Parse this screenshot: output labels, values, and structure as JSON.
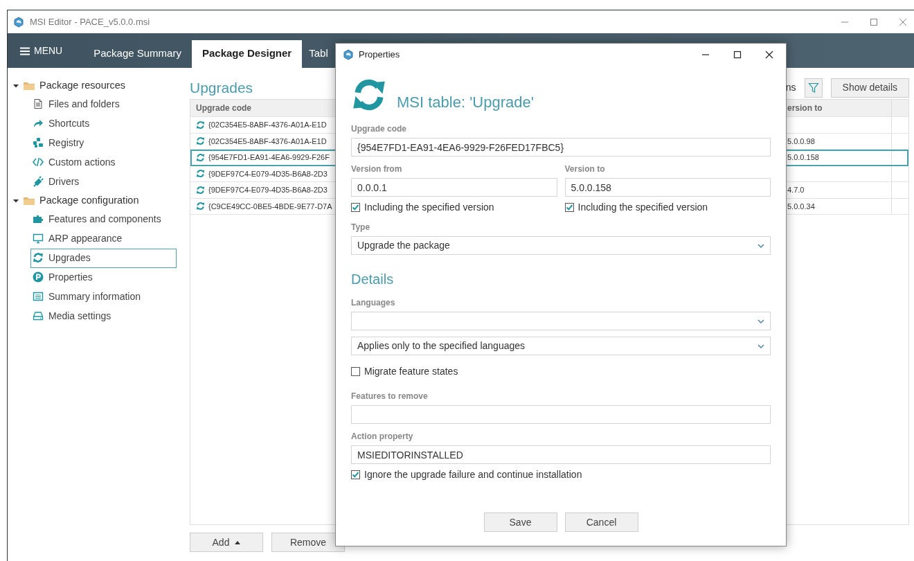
{
  "window": {
    "title": "MSI Editor - PACE_v5.0.0.msi"
  },
  "nav": {
    "menu": "MENU",
    "tabs": [
      {
        "label": "Package Summary",
        "selected": false
      },
      {
        "label": "Package Designer",
        "selected": true
      },
      {
        "label": "Tabl",
        "selected": false
      }
    ]
  },
  "sidebar": {
    "groups": [
      {
        "label": "Package resources",
        "expanded": true,
        "children": [
          {
            "label": "Files and folders",
            "selected": false
          },
          {
            "label": "Shortcuts",
            "selected": false
          },
          {
            "label": "Registry",
            "selected": false
          },
          {
            "label": "Custom actions",
            "selected": false
          },
          {
            "label": "Drivers",
            "selected": false
          }
        ]
      },
      {
        "label": "Package configuration",
        "expanded": true,
        "children": [
          {
            "label": "Features and components",
            "selected": false
          },
          {
            "label": "ARP appearance",
            "selected": false
          },
          {
            "label": "Upgrades",
            "selected": true
          },
          {
            "label": "Properties",
            "selected": false
          },
          {
            "label": "Summary information",
            "selected": false
          },
          {
            "label": "Media settings",
            "selected": false
          }
        ]
      }
    ]
  },
  "main": {
    "title": "Upgrades",
    "toolbar_text": "ns",
    "show_details": "Show details",
    "table": {
      "columns": [
        "Upgrade code",
        "ersion to"
      ],
      "rows": [
        {
          "code": "{02C354E5-8ABF-4376-A01A-E1D",
          "selected": false
        },
        {
          "code": "{02C354E5-8ABF-4376-A01A-E1D",
          "version_to": "5.0.0.98",
          "selected": false
        },
        {
          "code": "{954E7FD1-EA91-4EA6-9929-F26F",
          "version_to": "5.0.0.158",
          "selected": true
        },
        {
          "code": "{9DEF97C4-E079-4D35-B6A8-2D3",
          "selected": false
        },
        {
          "code": "{9DEF97C4-E079-4D35-B6A8-2D3",
          "version_to": "4.7.0",
          "selected": false
        },
        {
          "code": "{C9CE49CC-0BE5-4BDE-9E77-D7A",
          "version_to": "5.0.0.34",
          "selected": false
        }
      ]
    },
    "buttons": {
      "add": "Add",
      "remove": "Remove"
    }
  },
  "dialog": {
    "title": "Properties",
    "heading": "MSI table: 'Upgrade'",
    "upgrade_code": {
      "label": "Upgrade code",
      "value": "{954E7FD1-EA91-4EA6-9929-F26FED17FBC5}"
    },
    "version_from": {
      "label": "Version from",
      "value": "0.0.0.1",
      "include": {
        "label": "Including the specified version",
        "checked": true
      }
    },
    "version_to": {
      "label": "Version to",
      "value": "5.0.0.158",
      "include": {
        "label": "Including the specified version",
        "checked": true
      }
    },
    "type": {
      "label": "Type",
      "value": "Upgrade the package"
    },
    "details_title": "Details",
    "languages": {
      "label": "Languages"
    },
    "language_mode": {
      "value": "Applies only to the specified languages"
    },
    "migrate": {
      "label": "Migrate feature states",
      "checked": false
    },
    "features_to_remove": {
      "label": "Features to remove"
    },
    "action_property": {
      "label": "Action property",
      "value": "MSIEDITORINSTALLED"
    },
    "ignore_failure": {
      "label": "Ignore the upgrade failure and continue installation",
      "checked": true
    },
    "buttons": {
      "save": "Save",
      "cancel": "Cancel"
    }
  }
}
